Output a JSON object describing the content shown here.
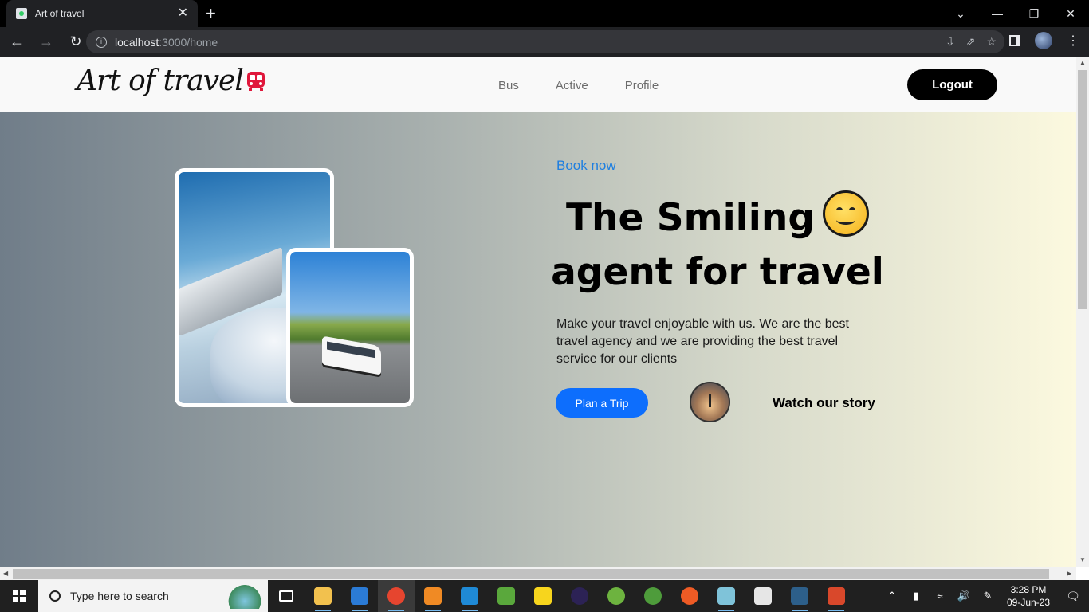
{
  "browser": {
    "tab_title": "Art of travel",
    "tab_close": "✕",
    "new_tab": "+",
    "url_host": "localhost",
    "url_path": ":3000/home",
    "window_controls": [
      "⌄",
      "—",
      "❐",
      "✕"
    ]
  },
  "site": {
    "logo_text": "Art of travel",
    "nav_links": [
      "Bus",
      "Active",
      "Profile"
    ],
    "logout_label": "Logout"
  },
  "hero": {
    "eyebrow": "Book now",
    "headline_line1": "The Smiling",
    "headline_line2": "agent for travel",
    "description": "Make your travel enjoyable with us. We are the best travel agency and we are providing the best travel service for our clients",
    "cta_label": "Plan a Trip",
    "story_label": "Watch our story"
  },
  "taskbar": {
    "search_placeholder": "Type here to search",
    "time": "3:28 PM",
    "date": "09-Jun-23",
    "apps": [
      {
        "name": "task-view-icon",
        "color": "#202020"
      },
      {
        "name": "file-explorer-icon",
        "color": "#f2c14e"
      },
      {
        "name": "store-icon",
        "color": "#2b7bd6"
      },
      {
        "name": "chrome-icon",
        "color": "#e6452f"
      },
      {
        "name": "sublime-text-icon",
        "color": "#f08a24"
      },
      {
        "name": "vscode-icon",
        "color": "#1f8ad6"
      },
      {
        "name": "bluej-icon",
        "color": "#5aa83c"
      },
      {
        "name": "sticky-notes-icon",
        "color": "#f7d51d"
      },
      {
        "name": "eclipse-icon",
        "color": "#2c2255"
      },
      {
        "name": "spring-tool-icon",
        "color": "#6db33f"
      },
      {
        "name": "spring-boot-icon",
        "color": "#4e9c3b"
      },
      {
        "name": "postman-icon",
        "color": "#ef5b25"
      },
      {
        "name": "notepad-icon",
        "color": "#7fc3d9"
      },
      {
        "name": "paint-icon",
        "color": "#e6e6e6"
      },
      {
        "name": "mysql-workbench-icon",
        "color": "#2d5f8a"
      },
      {
        "name": "git-gui-icon",
        "color": "#d9482b"
      }
    ]
  },
  "colors": {
    "accent_blue": "#0d6efd",
    "link_blue": "#1f7fe0",
    "logout_bg": "#000000"
  }
}
